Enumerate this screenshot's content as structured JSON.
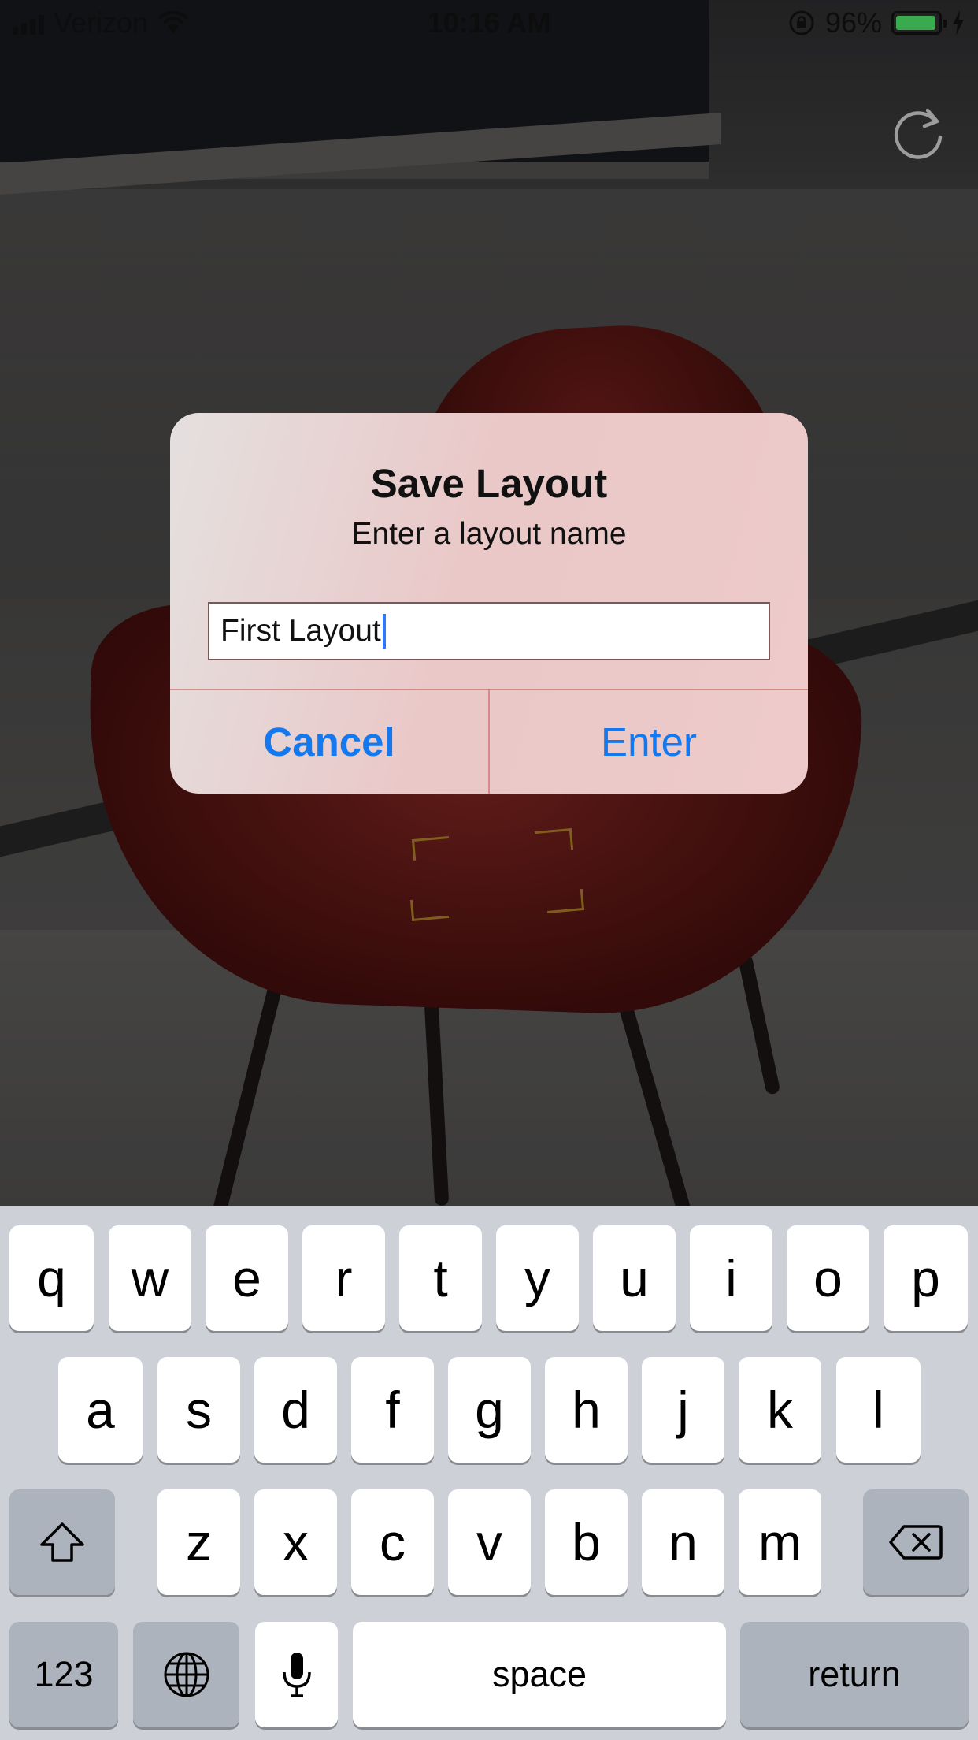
{
  "status_bar": {
    "carrier": "Verizon",
    "time": "10:16 AM",
    "battery": "96%",
    "battery_level": 0.96
  },
  "alert": {
    "title": "Save Layout",
    "message": "Enter a layout name",
    "input_value": "First Layout",
    "cancel_label": "Cancel",
    "enter_label": "Enter"
  },
  "keyboard": {
    "row1": [
      "q",
      "w",
      "e",
      "r",
      "t",
      "y",
      "u",
      "i",
      "o",
      "p"
    ],
    "row2": [
      "a",
      "s",
      "d",
      "f",
      "g",
      "h",
      "j",
      "k",
      "l"
    ],
    "row3": [
      "z",
      "x",
      "c",
      "v",
      "b",
      "n",
      "m"
    ],
    "numbers_label": "123",
    "space_label": "space",
    "return_label": "return"
  },
  "colors": {
    "accent": "#1479ee",
    "battery": "#4cd964"
  }
}
